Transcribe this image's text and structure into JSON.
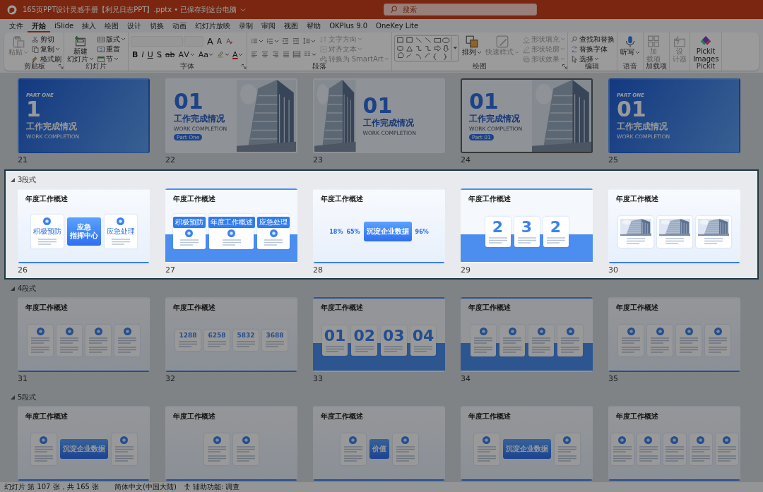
{
  "window": {
    "title": "165页PPT设计灵感手册【利兄日志PPT】.pptx • 已保存到这台电脑",
    "search": {
      "placeholder": "搜索"
    }
  },
  "menu": [
    {
      "label": "文件",
      "selected": false
    },
    {
      "label": "开始",
      "selected": true
    },
    {
      "label": "iSlide",
      "selected": false
    },
    {
      "label": "插入",
      "selected": false
    },
    {
      "label": "绘图",
      "selected": false
    },
    {
      "label": "设计",
      "selected": false
    },
    {
      "label": "切换",
      "selected": false
    },
    {
      "label": "动画",
      "selected": false
    },
    {
      "label": "幻灯片放映",
      "selected": false
    },
    {
      "label": "录制",
      "selected": false
    },
    {
      "label": "审阅",
      "selected": false
    },
    {
      "label": "视图",
      "selected": false
    },
    {
      "label": "帮助",
      "selected": false
    },
    {
      "label": "OKPlus 9.0",
      "selected": false
    },
    {
      "label": "OneKey Lite",
      "selected": false
    }
  ],
  "ribbon": {
    "groups": [
      {
        "label": "剪贴板",
        "launcher": true,
        "columns": [
          [
            {
              "kind": "large",
              "lines": [
                "粘贴"
              ],
              "disabled": true,
              "dropdown": true
            }
          ],
          [
            {
              "kind": "small",
              "label": "剪切",
              "disabled": false,
              "dropdown": false
            },
            {
              "kind": "small",
              "label": "复制",
              "disabled": false,
              "dropdown": true
            },
            {
              "kind": "small",
              "label": "格式刷",
              "disabled": false,
              "dropdown": false
            }
          ]
        ]
      },
      {
        "label": "幻灯片",
        "launcher": false,
        "columns": [
          [
            {
              "kind": "large",
              "lines": [
                "新建",
                "幻灯片"
              ],
              "disabled": false,
              "dropdown": true
            }
          ],
          [
            {
              "kind": "small",
              "label": "版式",
              "disabled": false,
              "dropdown": true
            },
            {
              "kind": "small",
              "label": "重置",
              "disabled": false,
              "dropdown": false
            },
            {
              "kind": "small",
              "label": "节",
              "disabled": false,
              "dropdown": true
            }
          ]
        ]
      },
      {
        "label": "字体",
        "launcher": true,
        "columns": [
          [
            {
              "kind": "row",
              "items": [
                {
                  "kind": "field",
                  "disabled": true
                },
                {
                  "kind": "field",
                  "disabled": true
                },
                {
                  "kind": "glyph",
                  "label": "A",
                  "disabled": false,
                  "dropdown": false
                },
                {
                  "kind": "glyph",
                  "label": "A",
                  "disabled": false,
                  "dropdown": false
                },
                {
                  "kind": "icon",
                  "disabled": false,
                  "dropdown": false
                }
              ]
            },
            {
              "kind": "row",
              "items": [
                {
                  "kind": "glyph",
                  "label": "B",
                  "disabled": false,
                  "dropdown": false
                },
                {
                  "kind": "glyph",
                  "label": "I",
                  "disabled": false,
                  "dropdown": false
                },
                {
                  "kind": "glyph",
                  "label": "U",
                  "disabled": false,
                  "dropdown": false
                },
                {
                  "kind": "glyph",
                  "label": "S",
                  "disabled": false,
                  "dropdown": false
                },
                {
                  "kind": "glyph",
                  "label": "ab",
                  "disabled": false,
                  "dropdown": false
                },
                {
                  "kind": "glyph",
                  "label": "AV",
                  "disabled": false,
                  "dropdown": true
                },
                {
                  "kind": "glyph",
                  "label": "Aa",
                  "disabled": false,
                  "dropdown": true
                },
                {
                  "kind": "icon",
                  "disabled": false,
                  "dropdown": true
                },
                {
                  "kind": "glyph",
                  "label": "A",
                  "disabled": false,
                  "dropdown": true
                }
              ]
            }
          ]
        ]
      },
      {
        "label": "段落",
        "launcher": false,
        "columns": [
          [
            {
              "kind": "row",
              "items": [
                {
                  "kind": "icon",
                  "disabled": false,
                  "dropdown": true
                },
                {
                  "kind": "icon",
                  "disabled": false,
                  "dropdown": true
                },
                {
                  "kind": "icon",
                  "disabled": false,
                  "dropdown": false
                },
                {
                  "kind": "icon",
                  "disabled": false,
                  "dropdown": false
                },
                {
                  "kind": "icon",
                  "disabled": false,
                  "dropdown": true
                }
              ]
            },
            {
              "kind": "row",
              "items": [
                {
                  "kind": "icon",
                  "disabled": false,
                  "dropdown": false
                },
                {
                  "kind": "icon",
                  "disabled": false,
                  "dropdown": false
                },
                {
                  "kind": "icon",
                  "disabled": false,
                  "dropdown": false
                },
                {
                  "kind": "icon",
                  "disabled": false,
                  "dropdown": false
                },
                {
                  "kind": "icon",
                  "disabled": false,
                  "dropdown": false
                },
                {
                  "kind": "icon",
                  "disabled": false,
                  "dropdown": true
                }
              ]
            }
          ],
          [
            {
              "kind": "small",
              "label": "文字方向",
              "disabled": true,
              "dropdown": true
            },
            {
              "kind": "small",
              "label": "对齐文本",
              "disabled": true,
              "dropdown": true
            },
            {
              "kind": "small",
              "label": "转换为 SmartArt",
              "disabled": true,
              "dropdown": true
            }
          ]
        ]
      },
      {
        "label": "绘图",
        "launcher": true,
        "columns": [
          [
            {
              "kind": "gallery",
              "disabled": false
            }
          ],
          [
            {
              "kind": "large",
              "lines": [
                "排列"
              ],
              "disabled": false,
              "dropdown": true
            }
          ],
          [
            {
              "kind": "large",
              "lines": [
                "快速样式"
              ],
              "disabled": true,
              "dropdown": true
            }
          ],
          [
            {
              "kind": "small",
              "label": "形状填充",
              "disabled": true,
              "dropdown": true
            },
            {
              "kind": "small",
              "label": "形状轮廓",
              "disabled": true,
              "dropdown": true
            },
            {
              "kind": "small",
              "label": "形状效果",
              "disabled": true,
              "dropdown": true
            }
          ]
        ]
      },
      {
        "label": "编辑",
        "launcher": false,
        "columns": [
          [
            {
              "kind": "small",
              "label": "查找和替换",
              "disabled": false,
              "dropdown": false
            },
            {
              "kind": "small",
              "label": "替换字体",
              "disabled": false,
              "dropdown": false
            },
            {
              "kind": "small",
              "label": "选择",
              "disabled": false,
              "dropdown": true
            }
          ]
        ]
      },
      {
        "label": "语音",
        "launcher": false,
        "columns": [
          [
            {
              "kind": "large",
              "lines": [
                "听写"
              ],
              "disabled": false,
              "dropdown": true
            }
          ]
        ]
      },
      {
        "label": "加载项",
        "launcher": false,
        "columns": [
          [
            {
              "kind": "large",
              "lines": [
                "加",
                "载项"
              ],
              "disabled": true,
              "dropdown": false
            }
          ]
        ]
      },
      {
        "launcher": false,
        "columns": [
          [
            {
              "kind": "large",
              "lines": [
                "设",
                "计器"
              ],
              "disabled": true,
              "dropdown": false
            }
          ]
        ]
      },
      {
        "label": "Pickit",
        "launcher": false,
        "columns": [
          [
            {
              "kind": "large",
              "lines": [
                "Pickit",
                "Images"
              ],
              "disabled": false,
              "dropdown": false
            }
          ]
        ]
      }
    ]
  },
  "slide_rows": [
    {
      "highlighted": false,
      "slides": [
        {
          "number": "21",
          "kind": "banner",
          "part": "PART ONE",
          "big": "1",
          "title": "工作完成情况",
          "subtitle": "WORK COMPLETION",
          "selected": false
        },
        {
          "number": "22",
          "big": "01",
          "title": "工作完成情况",
          "subtitle": "WORK COMPLETION",
          "tag": "Part One",
          "selected": false
        },
        {
          "number": "23",
          "kind": "split",
          "big": "01",
          "title": "工作完成情况",
          "subtitle": "WORK COMPLETION",
          "selected": false
        },
        {
          "number": "24",
          "big": "01",
          "title": "工作完成情况",
          "subtitle": "WORK COMPLETION",
          "tag": "Part 01",
          "selected": true
        },
        {
          "number": "25",
          "kind": "banner",
          "part": "PART ONE",
          "big": "01",
          "title": "工作完成情况",
          "subtitle": "WORK COMPLETION",
          "selected": false
        }
      ]
    },
    {
      "label": "3段式",
      "expanded": true,
      "highlighted": true,
      "slides": [
        {
          "number": "26",
          "kind": "overview",
          "title": "年度工作概述",
          "band": false,
          "selected": false,
          "cards": [
            {
              "kind": "text",
              "text": "积极预防"
            },
            {
              "kind": "feature",
              "lines": [
                "应急",
                "指挥中心"
              ]
            },
            {
              "kind": "text",
              "text": "应急处理"
            }
          ]
        },
        {
          "number": "27",
          "kind": "overview",
          "title": "年度工作概述",
          "band": true,
          "selected": false,
          "cards": [
            {
              "kind": "header",
              "text": "积极预防"
            },
            {
              "kind": "header",
              "text": "年度工作概述"
            },
            {
              "kind": "header",
              "text": "应急处理"
            }
          ]
        },
        {
          "number": "28",
          "kind": "overview",
          "title": "年度工作概述",
          "band": false,
          "selected": false,
          "cards": [
            {
              "kind": "stat",
              "text": "18%"
            },
            {
              "kind": "stat",
              "text": "65%"
            },
            {
              "kind": "feature",
              "lines": [
                "沉淀企业数据"
              ]
            },
            {
              "kind": "stat",
              "text": "96%"
            }
          ]
        },
        {
          "number": "29",
          "kind": "overview",
          "title": "年度工作概述",
          "band": true,
          "selected": false,
          "cards": [
            {
              "kind": "number",
              "text": "2"
            },
            {
              "kind": "number",
              "text": "3"
            },
            {
              "kind": "number",
              "text": "2"
            }
          ]
        },
        {
          "number": "30",
          "kind": "overview",
          "title": "年度工作概述",
          "band": false,
          "selected": false
        }
      ]
    },
    {
      "label": "4段式",
      "expanded": true,
      "highlighted": false,
      "slides": [
        {
          "number": "31",
          "kind": "overview",
          "title": "年度工作概述",
          "band": false,
          "selected": false,
          "cards": [
            {
              "kind": "blank"
            },
            {
              "kind": "blank"
            },
            {
              "kind": "blank"
            },
            {
              "kind": "blank"
            }
          ]
        },
        {
          "number": "32",
          "kind": "overview",
          "title": "年度工作概述",
          "band": false,
          "selected": false,
          "cards": [
            {
              "kind": "number",
              "text": "1288"
            },
            {
              "kind": "number",
              "text": "6258"
            },
            {
              "kind": "number",
              "text": "5832"
            },
            {
              "kind": "number",
              "text": "3688"
            }
          ]
        },
        {
          "number": "33",
          "kind": "overview",
          "title": "年度工作概述",
          "band": true,
          "selected": false,
          "cards": [
            {
              "kind": "number",
              "text": "01"
            },
            {
              "kind": "number",
              "text": "02"
            },
            {
              "kind": "number",
              "text": "03"
            },
            {
              "kind": "number",
              "text": "04"
            }
          ]
        },
        {
          "number": "34",
          "kind": "overview",
          "title": "年度工作概述",
          "band": true,
          "selected": false,
          "cards": [
            {
              "kind": "blank"
            },
            {
              "kind": "blank"
            },
            {
              "kind": "blank"
            },
            {
              "kind": "blank"
            }
          ]
        },
        {
          "number": "35",
          "kind": "overview",
          "title": "年度工作概述",
          "band": false,
          "selected": false,
          "cards": [
            {
              "kind": "blank"
            },
            {
              "kind": "blank"
            },
            {
              "kind": "blank"
            },
            {
              "kind": "blank"
            }
          ]
        }
      ]
    },
    {
      "label": "5段式",
      "expanded": true,
      "highlighted": false,
      "slides": [
        {
          "kind": "overview",
          "title": "年度工作概述",
          "band": false,
          "selected": false,
          "cards": [
            {
              "kind": "blank"
            },
            {
              "kind": "feature",
              "lines": [
                "沉淀企业数据"
              ]
            },
            {
              "kind": "blank"
            }
          ]
        },
        {
          "kind": "overview",
          "title": "年度工作概述",
          "band": false,
          "selected": false,
          "cards": [
            {
              "kind": "blank"
            },
            {
              "kind": "blank"
            }
          ]
        },
        {
          "kind": "overview",
          "title": "年度工作概述",
          "band": false,
          "selected": false,
          "cards": [
            {
              "kind": "blank"
            },
            {
              "kind": "feature",
              "lines": [
                "价值"
              ]
            },
            {
              "kind": "blank"
            }
          ]
        },
        {
          "kind": "overview",
          "title": "年度工作概述",
          "band": false,
          "selected": false,
          "cards": [
            {
              "kind": "blank"
            },
            {
              "kind": "feature",
              "lines": [
                "沉淀企业数据"
              ]
            },
            {
              "kind": "blank"
            }
          ]
        },
        {
          "kind": "overview",
          "title": "年度工作概述",
          "band": false,
          "selected": false,
          "cards": [
            {
              "kind": "blank"
            },
            {
              "kind": "blank"
            },
            {
              "kind": "blank"
            },
            {
              "kind": "blank"
            },
            {
              "kind": "blank"
            }
          ]
        }
      ]
    }
  ],
  "status_bar": {
    "slide_info": "幻灯片 第 107 张，共 165 张",
    "language": "简体中文(中国大陆)",
    "accessibility": "辅助功能: 调查"
  }
}
